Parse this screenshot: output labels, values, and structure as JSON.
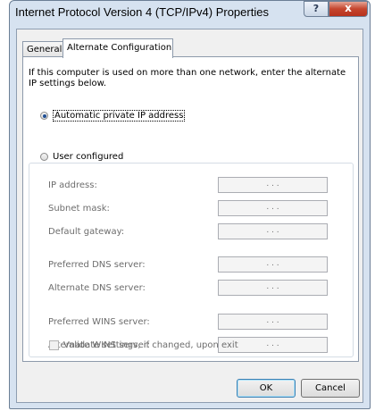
{
  "window": {
    "title": "Internet Protocol Version 4 (TCP/IPv4) Properties",
    "help_glyph": "?",
    "close_glyph": "x"
  },
  "tabs": [
    {
      "label": "General",
      "selected": false
    },
    {
      "label": "Alternate Configuration",
      "selected": true
    }
  ],
  "intro_text": "If this computer is used on more than one network, enter the alternate IP settings below.",
  "options": {
    "automatic": {
      "label": "Automatic private IP address",
      "selected": true
    },
    "user": {
      "label": "User configured",
      "selected": false
    }
  },
  "fields": [
    {
      "label": "IP address:",
      "value": ". . ."
    },
    {
      "label": "Subnet mask:",
      "value": ". . ."
    },
    {
      "label": "Default gateway:",
      "value": ". . ."
    },
    {
      "label": "Preferred DNS server:",
      "value": ". . ."
    },
    {
      "label": "Alternate DNS server:",
      "value": ". . ."
    },
    {
      "label": "Preferred WINS server:",
      "value": ". . ."
    },
    {
      "label": "Alternate WINS server:",
      "value": ". . ."
    }
  ],
  "validate": {
    "label": "Validate settings, if changed, upon exit",
    "checked": false
  },
  "buttons": {
    "ok": "OK",
    "cancel": "Cancel"
  },
  "colors": {
    "accent": "#3c7fb1",
    "close": "#c5452e",
    "disabled_text": "#6d6d6d"
  }
}
